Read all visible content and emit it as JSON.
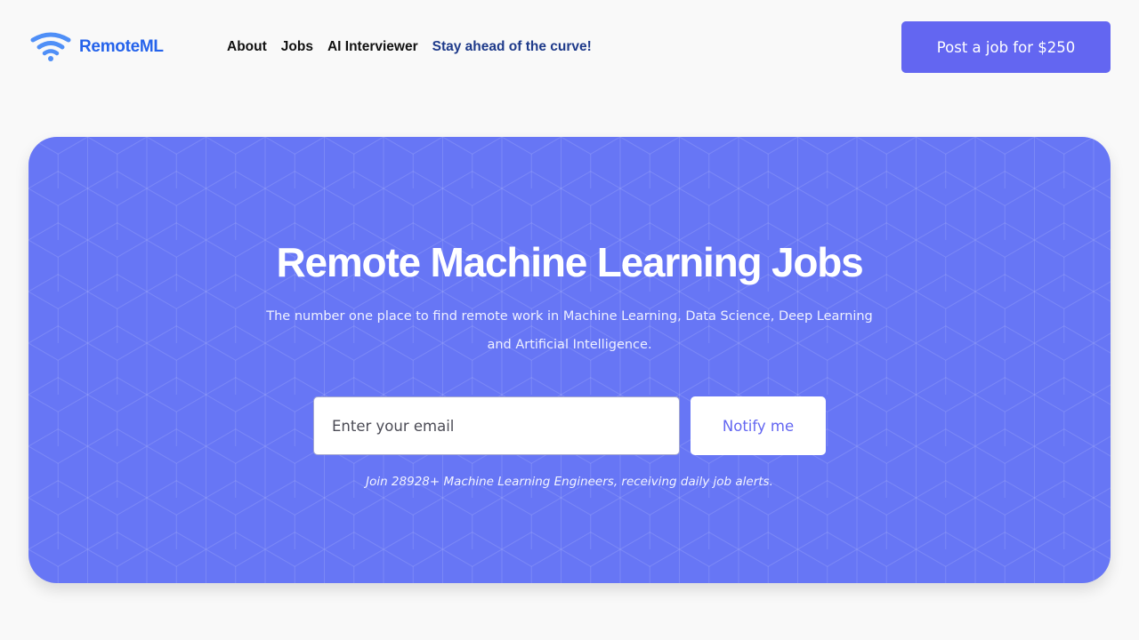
{
  "header": {
    "logo_text": "RemoteML",
    "logo_icon": "wifi-icon",
    "nav": [
      {
        "label": "About"
      },
      {
        "label": "Jobs"
      },
      {
        "label": "AI Interviewer"
      },
      {
        "label": "Stay ahead of the curve!"
      }
    ],
    "post_job_label": "Post a job for $250"
  },
  "hero": {
    "title": "Remote Machine Learning Jobs",
    "subtitle": "The number one place to find remote work in Machine Learning, Data Science, Deep Learning and Artificial Intelligence.",
    "email_placeholder": "Enter your email",
    "notify_label": "Notify me",
    "note": "Join 28928+ Machine Learning Engineers, receiving daily job alerts."
  },
  "colors": {
    "brand_blue": "#2563eb",
    "accent_indigo": "#6366f1",
    "hero_background": "#6776f5",
    "highlight_link": "#1e3a8a",
    "page_background": "#f9f9f9"
  }
}
